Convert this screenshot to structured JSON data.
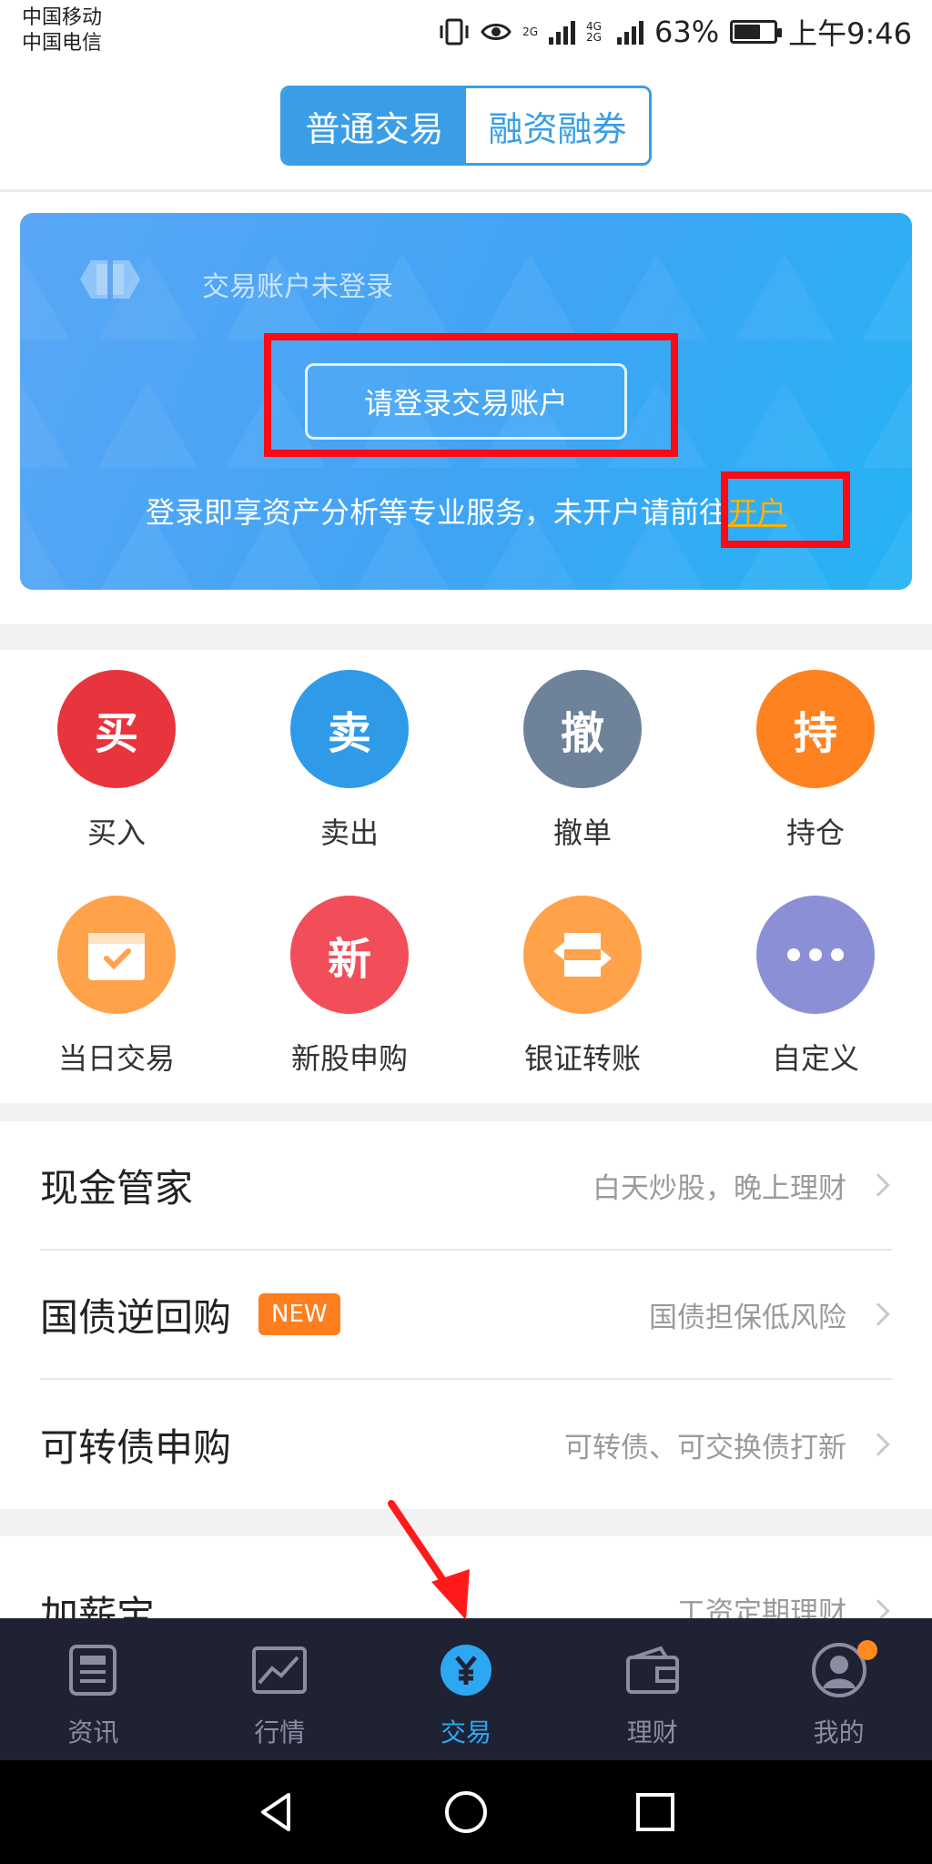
{
  "status_bar": {
    "carrier1": "中国移动",
    "carrier2": "中国电信",
    "network1": "2G",
    "network2": "4G 2G",
    "battery": "63%",
    "time": "上午9:46"
  },
  "tabs": [
    {
      "label": "普通交易",
      "active": true
    },
    {
      "label": "融资融券",
      "active": false
    }
  ],
  "login_card": {
    "status_text": "交易账户未登录",
    "login_button": "请登录交易账户",
    "hint_text": "登录即享资产分析等专业服务，未开户请前往",
    "open_account_link": "开户"
  },
  "functions": [
    {
      "glyph": "买",
      "label": "买入",
      "color": "#e8343c"
    },
    {
      "glyph": "卖",
      "label": "卖出",
      "color": "#2f9be8"
    },
    {
      "glyph": "撤",
      "label": "撤单",
      "color": "#6e8299"
    },
    {
      "glyph": "持",
      "label": "持仓",
      "color": "#ff8220"
    },
    {
      "glyph": "calendar-icon",
      "label": "当日交易",
      "color": "#ffa24a"
    },
    {
      "glyph": "新",
      "label": "新股申购",
      "color": "#f24e5a"
    },
    {
      "glyph": "transfer-icon",
      "label": "银证转账",
      "color": "#ffa24a"
    },
    {
      "glyph": "more-icon",
      "label": "自定义",
      "color": "#8b90d6"
    }
  ],
  "list": [
    {
      "title": "现金管家",
      "desc": "白天炒股，晚上理财"
    },
    {
      "title": "国债逆回购",
      "badge": "NEW",
      "desc": "国债担保低风险"
    },
    {
      "title": "可转债申购",
      "desc": "可转债、可交换债打新"
    },
    {
      "title": "加薪宝",
      "desc": "工资定期理财"
    }
  ],
  "bottom_nav": [
    {
      "label": "资讯",
      "icon": "news-icon"
    },
    {
      "label": "行情",
      "icon": "chart-icon"
    },
    {
      "label": "交易",
      "icon": "yuan-icon",
      "active": true
    },
    {
      "label": "理财",
      "icon": "wallet-icon"
    },
    {
      "label": "我的",
      "icon": "avatar-icon"
    }
  ],
  "colors": {
    "accent": "#3a9ee6",
    "nav_bg": "#1f2233",
    "highlight": "#ff0a14"
  }
}
